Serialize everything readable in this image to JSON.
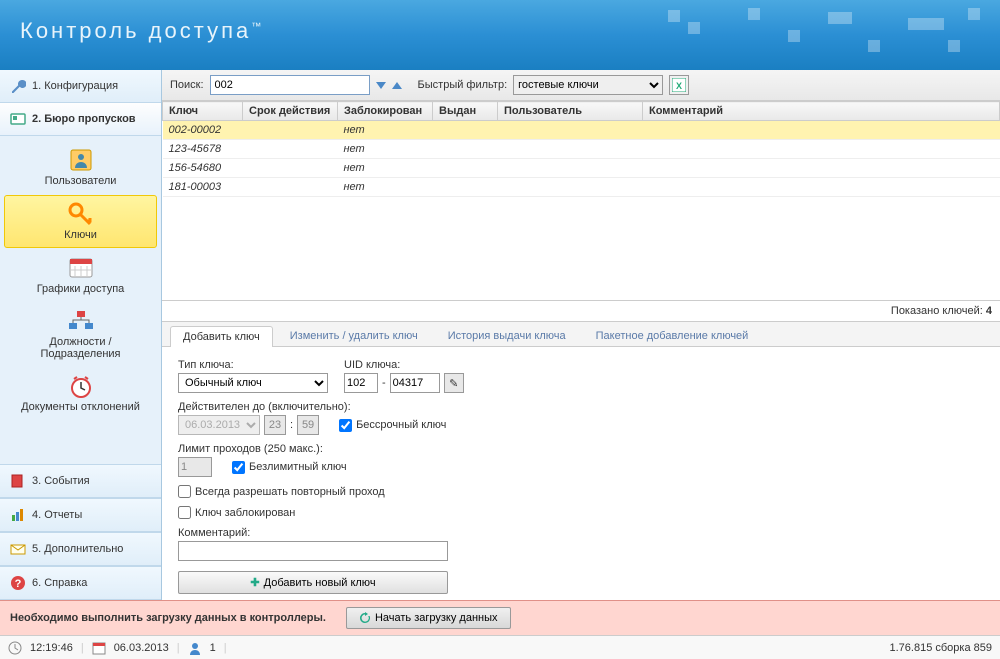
{
  "app_title": "Контроль доступа",
  "colors": {
    "accent": "#2b8fd4",
    "warn": "#ffd6d0"
  },
  "sidebar": {
    "items": [
      {
        "label": "1. Конфигурация",
        "icon": "wrench-icon"
      },
      {
        "label": "2. Бюро пропусков",
        "icon": "card-icon"
      },
      {
        "label": "3. События",
        "icon": "book-icon"
      },
      {
        "label": "4. Отчеты",
        "icon": "chart-icon"
      },
      {
        "label": "5. Дополнительно",
        "icon": "mail-icon"
      },
      {
        "label": "6. Справка",
        "icon": "help-icon"
      }
    ],
    "sub": [
      {
        "label": "Пользователи"
      },
      {
        "label": "Ключи"
      },
      {
        "label": "Графики доступа"
      },
      {
        "label": "Должности / Подразделения"
      },
      {
        "label": "Документы отклонений"
      }
    ]
  },
  "toolbar": {
    "search_label": "Поиск:",
    "search_value": "002",
    "filter_label": "Быстрый фильтр:",
    "filter_value": "гостевые ключи"
  },
  "grid": {
    "columns": [
      "Ключ",
      "Срок действия",
      "Заблокирован",
      "Выдан",
      "Пользователь",
      "Комментарий"
    ],
    "rows": [
      {
        "key": "002-00002",
        "valid": "",
        "blocked": "нет",
        "issued": "",
        "user": "",
        "comment": ""
      },
      {
        "key": "123-45678",
        "valid": "",
        "blocked": "нет",
        "issued": "",
        "user": "",
        "comment": ""
      },
      {
        "key": "156-54680",
        "valid": "",
        "blocked": "нет",
        "issued": "",
        "user": "",
        "comment": ""
      },
      {
        "key": "181-00003",
        "valid": "",
        "blocked": "нет",
        "issued": "",
        "user": "",
        "comment": ""
      }
    ],
    "count_label": "Показано ключей:",
    "count_value": "4"
  },
  "tabs": [
    "Добавить ключ",
    "Изменить / удалить ключ",
    "История выдачи ключа",
    "Пакетное добавление ключей"
  ],
  "form": {
    "type_label": "Тип ключа:",
    "type_value": "Обычный ключ",
    "uid_label": "UID ключа:",
    "uid1": "102",
    "uid2": "04317",
    "valid_label": "Действителен до (включительно):",
    "valid_date": "06.03.2013",
    "valid_h": "23",
    "valid_m": "59",
    "unlimited_label": "Бессрочный ключ",
    "limit_label": "Лимит проходов (250 макс.):",
    "limit_value": "1",
    "unlimited_pass_label": "Безлимитный ключ",
    "repass_label": "Всегда разрешать повторный проход",
    "blocked_label": "Ключ заблокирован",
    "comment_label": "Комментарий:",
    "add_btn": "Добавить новый ключ"
  },
  "warn": {
    "text": "Необходимо выполнить загрузку данных в контроллеры.",
    "btn": "Начать загрузку данных"
  },
  "status": {
    "time": "12:19:46",
    "date": "06.03.2013",
    "users": "1",
    "version": "1.76.815 сборка 859"
  }
}
